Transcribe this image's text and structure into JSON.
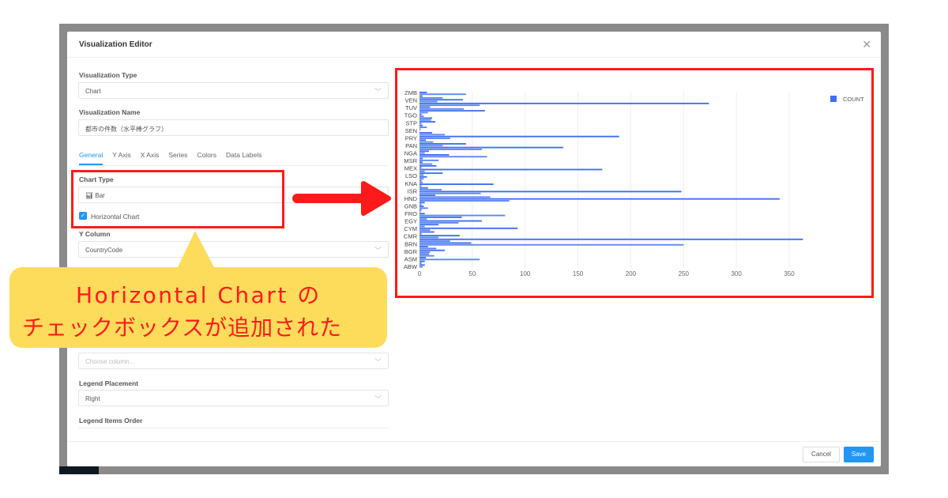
{
  "modal": {
    "title": "Visualization Editor",
    "close_icon": "close-icon",
    "visualization_type": {
      "label": "Visualization Type",
      "value": "Chart"
    },
    "visualization_name": {
      "label": "Visualization Name",
      "value": "都市の件数（水平棒グラフ）"
    },
    "tabs": [
      {
        "label": "General",
        "active": true
      },
      {
        "label": "Y Axis"
      },
      {
        "label": "X Axis"
      },
      {
        "label": "Series"
      },
      {
        "label": "Colors"
      },
      {
        "label": "Data Labels"
      }
    ],
    "chart_type": {
      "label": "Chart Type",
      "value": "Bar",
      "icon": "bar-chart-icon"
    },
    "horizontal_chart": {
      "label": "Horizontal Chart",
      "checked": true
    },
    "y_column": {
      "label": "Y Column",
      "value": "CountryCode"
    },
    "group_by": {
      "placeholder": "Choose column..."
    },
    "legend_placement": {
      "label": "Legend Placement",
      "value": "Right"
    },
    "legend_items_order": {
      "label": "Legend Items Order"
    },
    "cancel_label": "Cancel",
    "save_label": "Save"
  },
  "annotation": {
    "line1": "Horizontal Chart の",
    "line2": "チェックボックスが追加された",
    "highlight_color": "#ff1a1a",
    "callout_color": "#fddc5c"
  },
  "chart_data": {
    "type": "bar",
    "orientation": "horizontal",
    "tick_labels": [
      "ZMB",
      "VEN",
      "TUV",
      "TGO",
      "STP",
      "SEN",
      "PRY",
      "PAN",
      "NGA",
      "MSR",
      "MEX",
      "LSO",
      "KNA",
      "ISR",
      "HND",
      "GNB",
      "FRO",
      "EGY",
      "CYM",
      "CMR",
      "BRN",
      "BGR",
      "ASM",
      "ABW"
    ],
    "series": [
      {
        "name": "COUNT",
        "color": "#3d6ef5",
        "values_top_to_bottom": [
          7,
          44,
          3,
          22,
          41,
          17,
          274,
          57,
          10,
          42,
          62,
          8,
          2,
          4,
          12,
          11,
          15,
          2,
          3,
          7,
          1,
          0,
          12,
          24,
          189,
          29,
          6,
          13,
          44,
          22,
          136,
          59,
          9,
          5,
          28,
          64,
          3,
          18,
          3,
          12,
          16,
          2,
          173,
          5,
          22,
          4,
          7,
          4,
          2,
          3,
          70,
          2,
          8,
          21,
          248,
          58,
          15,
          67,
          341,
          85,
          5,
          2,
          4,
          8,
          2,
          1,
          5,
          81,
          40,
          7,
          59,
          37,
          18,
          5,
          93,
          10,
          14,
          2,
          38,
          18,
          363,
          29,
          49,
          250,
          8,
          16,
          24,
          10,
          9,
          14,
          6,
          57,
          5,
          2,
          5,
          3
        ]
      }
    ],
    "xlim": [
      0,
      365
    ],
    "x_ticks": [
      0,
      50,
      100,
      150,
      200,
      250,
      300,
      350
    ],
    "grid": true,
    "legend": "top-right"
  }
}
